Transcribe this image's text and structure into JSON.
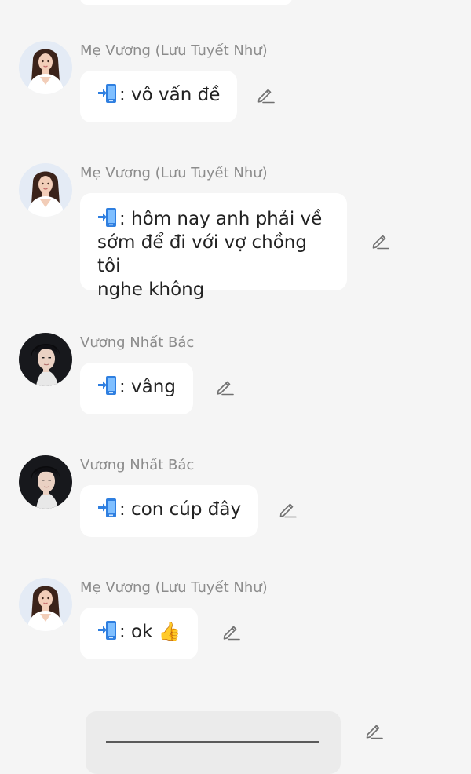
{
  "icon_prefix": "phone-arrow-icon",
  "edit_icon": "pencil-icon",
  "messages": [
    {
      "sender": "Mẹ Vương (Lưu Tuyết Như)",
      "text": ": vô vấn đề",
      "avatar": "female-avatar"
    },
    {
      "sender": "Mẹ Vương (Lưu Tuyết Như)",
      "text": ": hôm nay anh phải về",
      "text2": "sớm để đi với vợ chồng tôi",
      "text3": "nghe không",
      "avatar": "female-avatar"
    },
    {
      "sender": "Vương Nhất Bác",
      "text": ": vâng",
      "avatar": "male-avatar"
    },
    {
      "sender": "Vương Nhất Bác",
      "text": ": con cúp đây",
      "avatar": "male-avatar"
    },
    {
      "sender": "Mẹ Vương (Lưu Tuyết Như)",
      "text": ": ok",
      "emoji": "👍",
      "avatar": "female-avatar"
    }
  ],
  "colors": {
    "background": "#f5f5f5",
    "bubble": "#ffffff",
    "sender_text": "#8c8c8c",
    "phone_blue": "#2f7fe0"
  }
}
